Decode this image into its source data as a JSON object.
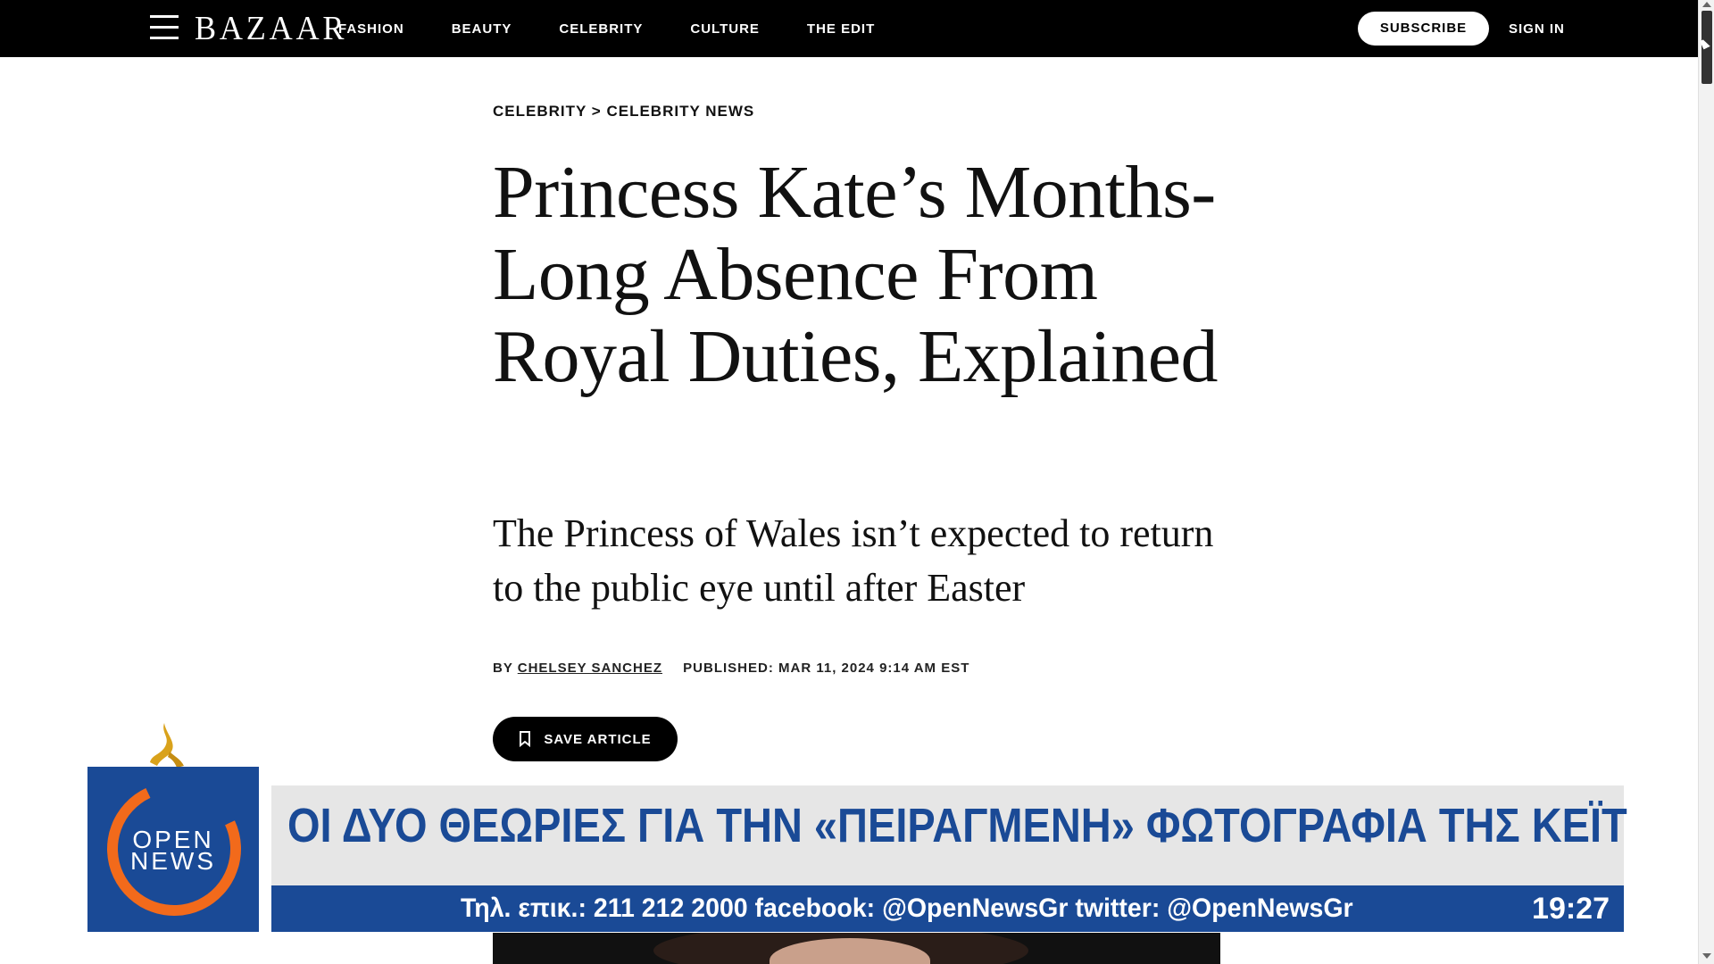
{
  "header": {
    "logo": "BAZAAR",
    "nav": [
      "FASHION",
      "BEAUTY",
      "CELEBRITY",
      "CULTURE",
      "THE EDIT"
    ],
    "subscribe_label": "SUBSCRIBE",
    "signin_label": "SIGN IN"
  },
  "article": {
    "breadcrumb": {
      "parent": "CELEBRITY",
      "separator": ">",
      "child": "CELEBRITY NEWS"
    },
    "headline": "Princess Kate’s Months-Long Absence From Royal Duties, Explained",
    "dek": "The Princess of Wales isn’t expected to return to the public eye until after Easter",
    "byline_prefix": "BY",
    "author": "CHELSEY SANCHEZ",
    "published": "PUBLISHED: MAR 11, 2024 9:14 AM EST",
    "save_label": "SAVE ARTICLE"
  },
  "overlay": {
    "channel_logo_line1": "OPEN",
    "channel_logo_line2": "NEWS",
    "headline": "ΟΙ ΔΥΟ ΘΕΩΡΙΕΣ ΓΙΑ ΤΗΝ «ΠΕΙΡΑΓΜΕΝΗ» ΦΩΤΟΓΡΑΦΙΑ ΤΗΣ ΚΕΪΤ",
    "contact": "Τηλ. επικ.: 211 212 2000 facebook: @OpenNewsGr twitter: @OpenNewsGr",
    "clock": "19:27",
    "colors": {
      "primary_blue": "#1a4a96",
      "accent_orange": "#f26a1b",
      "bar_gray": "#e6e6e6"
    }
  }
}
